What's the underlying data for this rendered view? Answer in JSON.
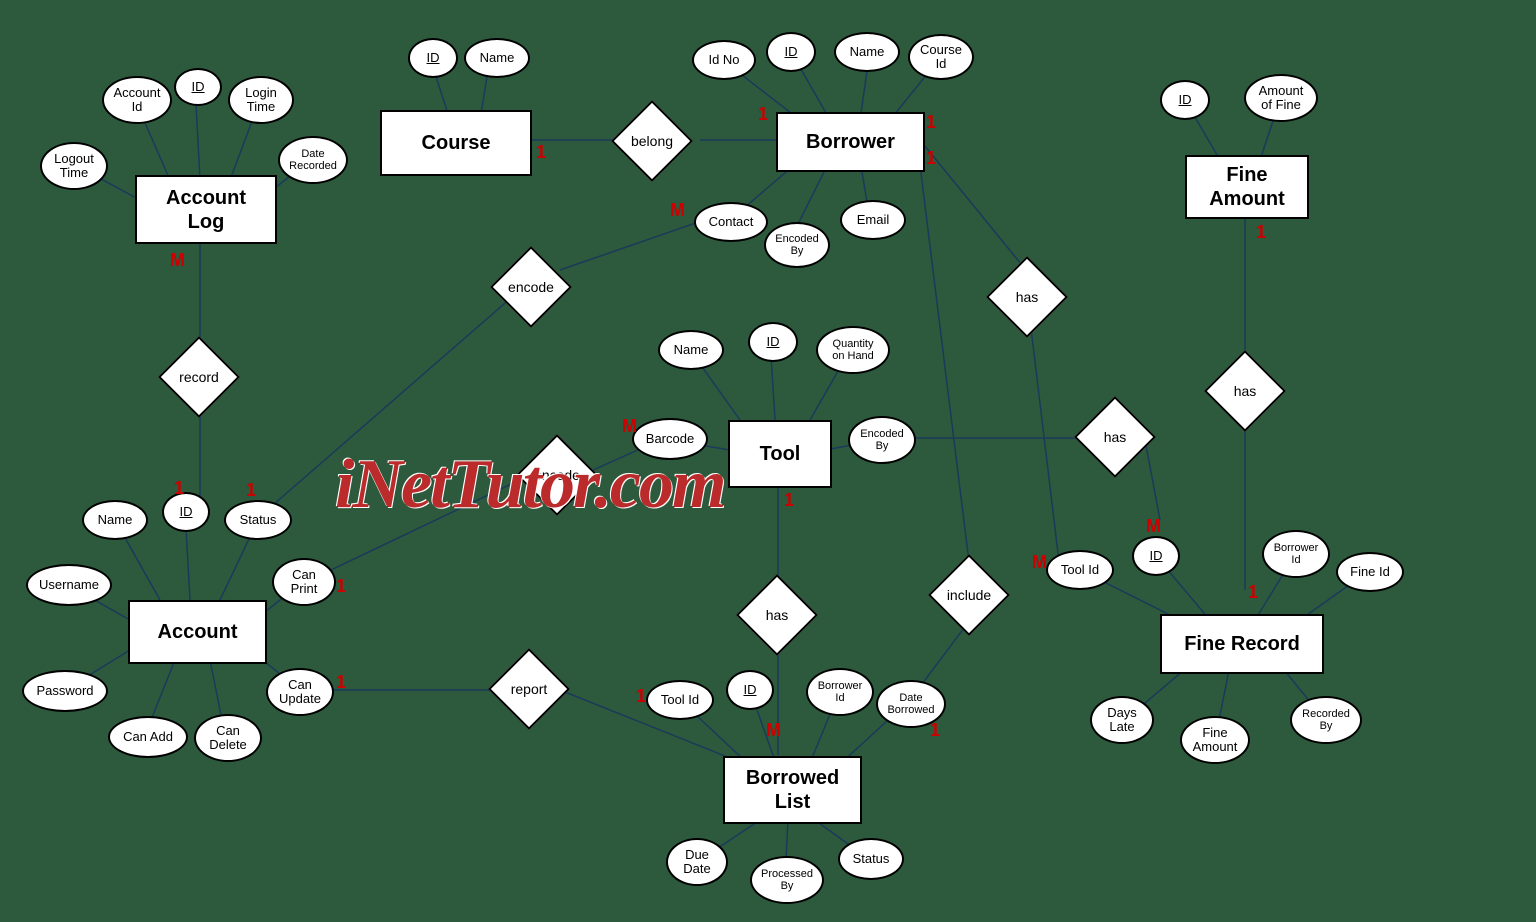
{
  "watermark": "iNetTutor.com",
  "entities": {
    "course": "Course",
    "borrower": "Borrower",
    "fine_amount": "Fine\nAmount",
    "account_log": "Account\nLog",
    "tool": "Tool",
    "account": "Account",
    "borrowed_list": "Borrowed\nList",
    "fine_record": "Fine Record"
  },
  "relationships": {
    "belong": "belong",
    "encode1": "encode",
    "encode2": "encode",
    "record": "record",
    "has1": "has",
    "has2": "has",
    "has3": "has",
    "has4": "has",
    "include": "include",
    "report": "report"
  },
  "attributes": {
    "course_id": "ID",
    "course_name": "Name",
    "borrower_idno": "Id No",
    "borrower_id": "ID",
    "borrower_name": "Name",
    "borrower_courseid": "Course\nId",
    "borrower_contact": "Contact",
    "borrower_email": "Email",
    "borrower_encodedby": "Encoded\nBy",
    "fineamount_id": "ID",
    "fineamount_amount": "Amount\nof Fine",
    "acclog_accountid": "Account\nId",
    "acclog_id": "ID",
    "acclog_logintime": "Login\nTime",
    "acclog_logouttime": "Logout\nTime",
    "acclog_daterec": "Date\nRecorded",
    "tool_name": "Name",
    "tool_id": "ID",
    "tool_qoh": "Quantity\non Hand",
    "tool_barcode": "Barcode",
    "tool_encodedby": "Encoded\nBy",
    "account_name": "Name",
    "account_id": "ID",
    "account_status": "Status",
    "account_username": "Username",
    "account_canprint": "Can\nPrint",
    "account_password": "Password",
    "account_canupdate": "Can\nUpdate",
    "account_canadd": "Can Add",
    "account_candelete": "Can\nDelete",
    "bl_toolid": "Tool Id",
    "bl_id": "ID",
    "bl_borrowerid": "Borrower\nId",
    "bl_dateborrowed": "Date\nBorrowed",
    "bl_duedate": "Due\nDate",
    "bl_processedby": "Processed\nBy",
    "bl_status": "Status",
    "fr_toolid": "Tool Id",
    "fr_id": "ID",
    "fr_borrowerid": "Borrower\nId",
    "fr_fineid": "Fine Id",
    "fr_dayslate": "Days\nLate",
    "fr_fineamount": "Fine\nAmount",
    "fr_recordedby": "Recorded\nBy"
  },
  "cardinalities": {
    "c1": "1",
    "c_m": "M"
  }
}
